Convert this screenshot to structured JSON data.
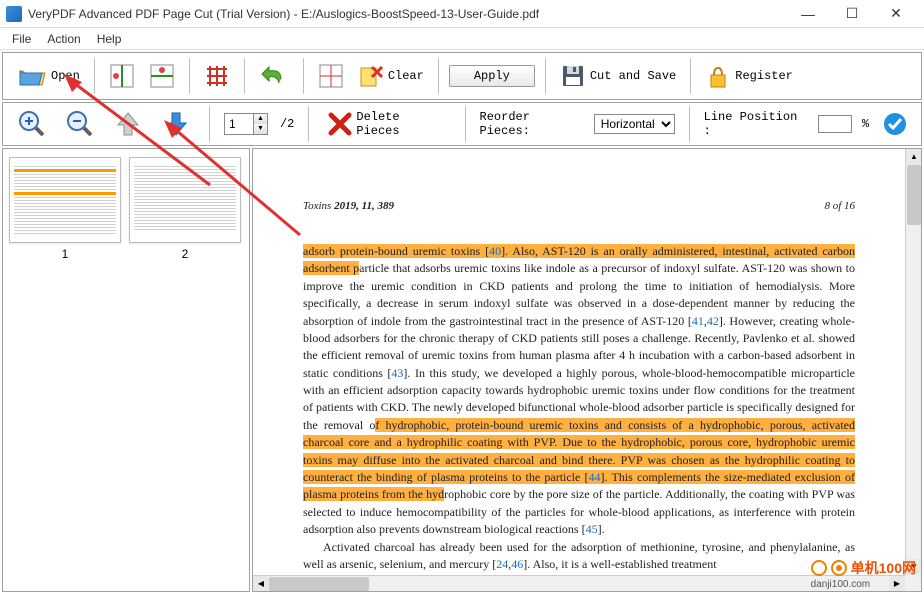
{
  "window": {
    "title": "VeryPDF Advanced PDF Page Cut (Trial Version)  -  E:/Auslogics-BoostSpeed-13-User-Guide.pdf"
  },
  "menu": {
    "file": "File",
    "action": "Action",
    "help": "Help"
  },
  "toolbar1": {
    "open": "Open",
    "clear": "Clear",
    "apply": "Apply",
    "cut_save": "Cut and Save",
    "register": "Register"
  },
  "toolbar2": {
    "page_current": "1",
    "page_total": "/2",
    "delete_pieces": "Delete Pieces",
    "reorder_label": "Reorder Pieces:",
    "reorder_value": "Horizontal",
    "line_position_label": "Line Position :",
    "line_position_value": "",
    "percent": "%"
  },
  "thumbs": {
    "p1": "1",
    "p2": "2"
  },
  "doc": {
    "journal": "Toxins",
    "issue": "2019, 11, 389",
    "page": "8 of 16",
    "hl1": "adsorb protein-bound uremic toxins [",
    "ref40": "40",
    "hl1b": "]. Also, AST-120 is an orally administered, intestinal, activated carbon adsorbent p",
    "t1": "article that adsorbs uremic toxins like indole as a precursor of indoxyl sulfate. AST-120 was shown to improve the uremic condition in CKD patients and prolong the time to initiation of hemodialysis. More specifically, a decrease in serum indoxyl sulfate was observed in a dose-dependent manner by reducing the absorption of indole from the gastrointestinal tract in the presence of AST-120 [",
    "ref41": "41",
    "comma": ",",
    "ref42": "42",
    "t2": "]. However, creating whole-blood adsorbers for the chronic therapy of CKD patients still poses a challenge. Recently, Pavlenko et al. showed the efficient removal of uremic toxins from human plasma after 4 h incubation with a carbon-based adsorbent in static conditions [",
    "ref43": "43",
    "t3": "]. In this study, we developed a highly porous, whole-blood-hemocompatible microparticle with an efficient adsorption capacity towards hydrophobic uremic toxins under flow conditions for the treatment of patients with CKD. The newly developed bifunctional whole-blood adsorber particle is specifically designed for the removal o",
    "hl2": "f hydrophobic, protein-bound uremic toxins and consists of a hydrophobic, porous, activated charcoal core and a hydrophilic coating with PVP. Due to the hydrophobic, porous core, hydrophobic uremic toxins may diffuse into the activated charcoal and bind there. PVP was chosen as the hydrophilic coating to counteract the binding of plasma proteins to the particle [",
    "ref44": "44",
    "hl2b": "]. This complements the size-mediated exclusion of plasma proteins from the hyd",
    "t4": "rophobic core by the pore size of the particle. Additionally, the coating with PVP was selected to induce hemocompatibility of the particles for whole-blood applications, as interference with protein adsorption also prevents downstream biological reactions [",
    "ref45": "45",
    "t5": "].",
    "p2a": "Activated charcoal has already been used for the adsorption of methionine, tyrosine, and phenylalanine, as well as arsenic, selenium, and mercury [",
    "ref24": "24",
    "ref46": "46",
    "p2b": "]. Also, it is a well-established treatment"
  },
  "watermark": {
    "brand": "单机100网",
    "url": "danji100.com"
  }
}
